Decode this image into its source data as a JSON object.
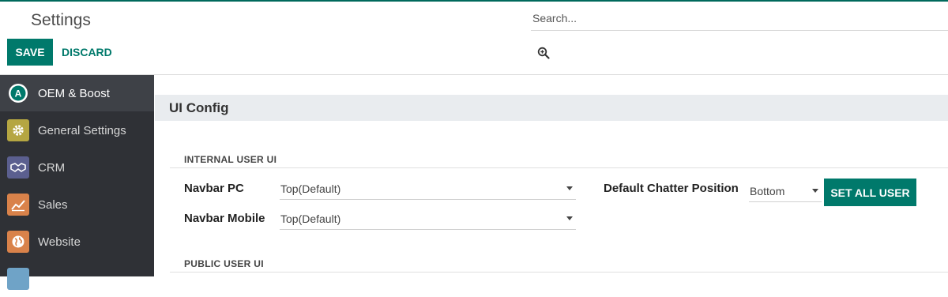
{
  "control_panel": {
    "title": "Settings",
    "save_label": "SAVE",
    "discard_label": "DISCARD",
    "search_placeholder": "Search..."
  },
  "sidebar": {
    "items": [
      {
        "label": "OEM & Boost",
        "icon": "oem-boost-logo-icon",
        "color": "#ffffff",
        "active": true
      },
      {
        "label": "General Settings",
        "icon": "gear-icon",
        "color": "#b5a642",
        "active": false
      },
      {
        "label": "CRM",
        "icon": "handshake-icon",
        "color": "#5b5f8f",
        "active": false
      },
      {
        "label": "Sales",
        "icon": "chart-line-icon",
        "color": "#d9824a",
        "active": false
      },
      {
        "label": "Website",
        "icon": "globe-icon",
        "color": "#d9824a",
        "active": false
      }
    ]
  },
  "main": {
    "section_title": "UI Config",
    "internal": {
      "title": "INTERNAL USER UI",
      "navbar_pc_label": "Navbar PC",
      "navbar_pc_value": "Top(Default)",
      "navbar_mobile_label": "Navbar Mobile",
      "navbar_mobile_value": "Top(Default)",
      "chatter_label": "Default Chatter Position",
      "chatter_value": "Bottom",
      "set_all_label": "SET ALL USER"
    },
    "public": {
      "title": "PUBLIC USER UI"
    }
  },
  "colors": {
    "accent": "#00796b",
    "sidebar_bg": "#2f3136",
    "section_bg": "#e9ecef"
  }
}
